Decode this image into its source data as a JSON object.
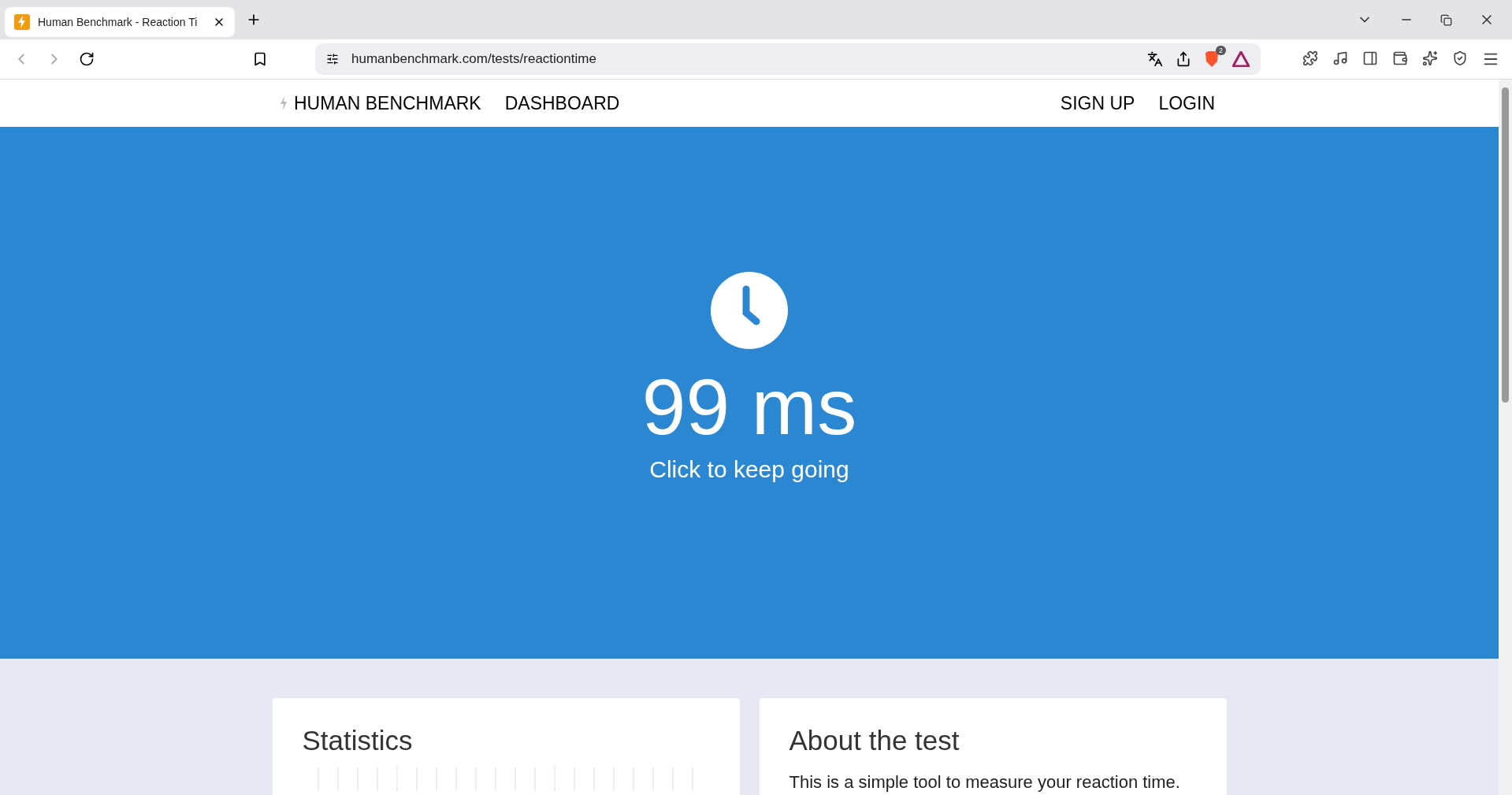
{
  "browser": {
    "tab": {
      "title": "Human Benchmark - Reaction Ti",
      "selected": true
    },
    "address": "humanbenchmark.com/tests/reactiontime",
    "shields_count": "2"
  },
  "nav": {
    "brand": "HUMAN BENCHMARK",
    "links": [
      "DASHBOARD"
    ],
    "account": [
      "SIGN UP",
      "LOGIN"
    ]
  },
  "hero": {
    "result": "99 ms",
    "prompt": "Click to keep going"
  },
  "cards": [
    {
      "title": "Statistics",
      "kind": "chart"
    },
    {
      "title": "About the test",
      "kind": "text",
      "text": "This is a simple tool to measure your reaction time."
    }
  ]
}
